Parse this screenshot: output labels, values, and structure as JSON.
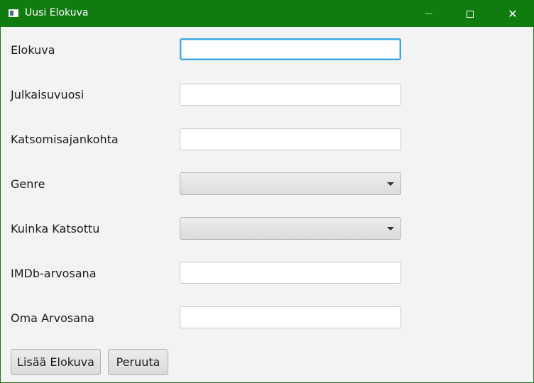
{
  "window": {
    "title": "Uusi Elokuva",
    "icon": "app-window-icon",
    "controls": {
      "minimize": "minimize-icon",
      "maximize": "maximize-icon",
      "close": "✕"
    },
    "accent_color": "#107c10"
  },
  "form": {
    "movie_label": "Elokuva",
    "movie_value": "",
    "year_label": "Julkaisuvuosi",
    "year_value": "",
    "watched_time_label": "Katsomisajankohta",
    "watched_time_value": "",
    "genre_label": "Genre",
    "genre_value": "",
    "how_watched_label": "Kuinka Katsottu",
    "how_watched_value": "",
    "imdb_label": "IMDb-arvosana",
    "imdb_value": "",
    "own_rating_label": "Oma Arvosana",
    "own_rating_value": ""
  },
  "buttons": {
    "add_label": "Lisää Elokuva",
    "cancel_label": "Peruuta"
  }
}
